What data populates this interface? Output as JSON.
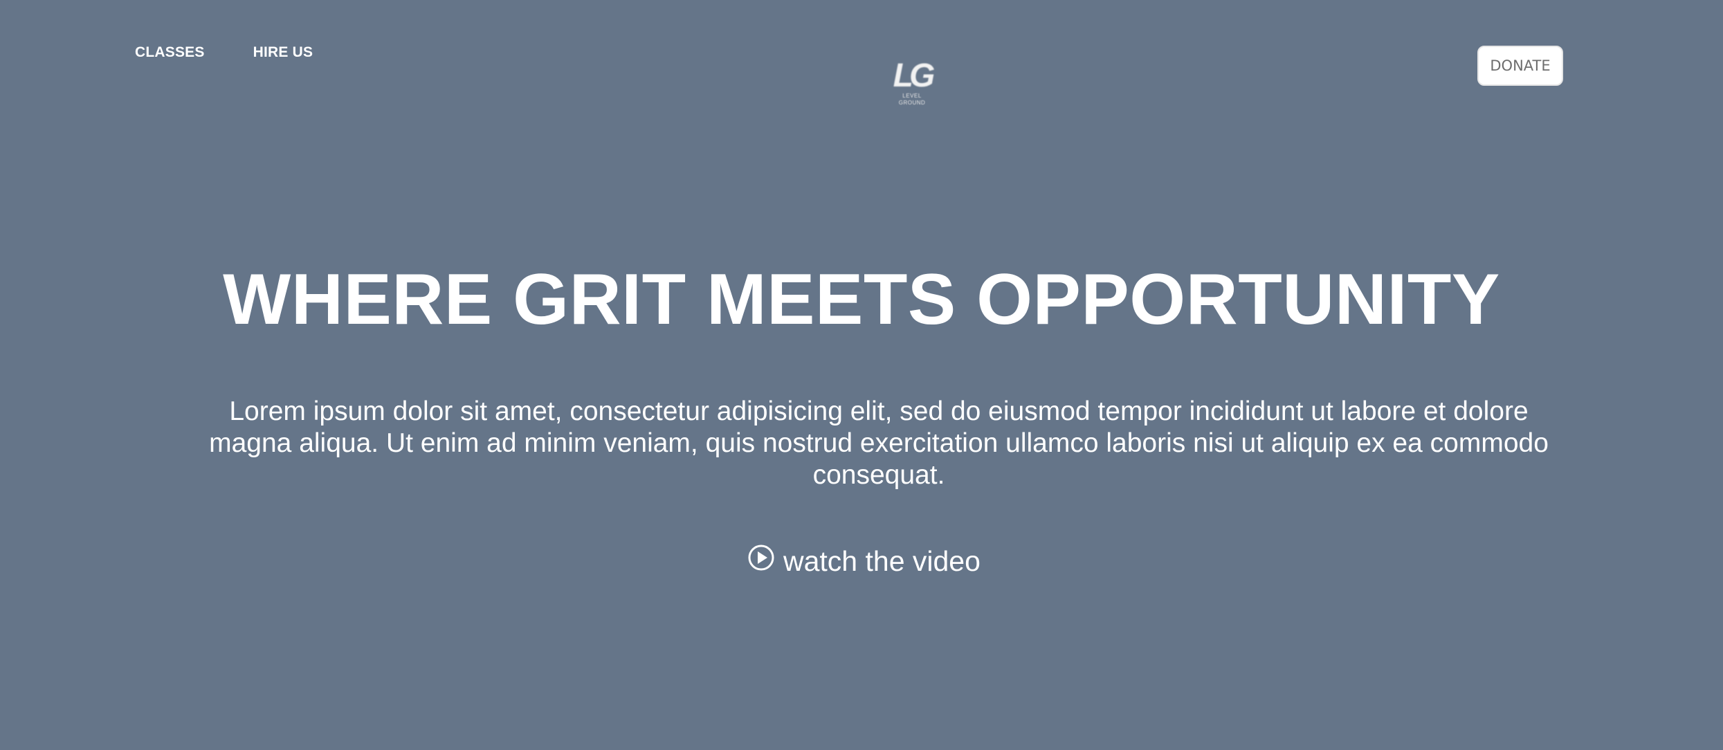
{
  "nav": {
    "items": [
      {
        "label": "CLASSES"
      },
      {
        "label": "HIRE US"
      }
    ]
  },
  "logo": {
    "mark": "LG",
    "subtext": "LEVEL GROUND"
  },
  "donate": {
    "label": "DONATE"
  },
  "hero": {
    "title": "WHERE GRIT MEETS OPPORTUNITY",
    "text": "Lorem ipsum dolor sit amet, consectetur adipisicing elit, sed do eiusmod tempor incididunt ut labore et dolore magna aliqua. Ut enim ad minim veniam, quis nostrud exercitation ullamco laboris nisi ut aliquip ex ea commodo consequat.",
    "video_link": "watch the video"
  },
  "colors": {
    "background": "#657589",
    "text": "#ffffff",
    "button_bg": "#ffffff",
    "button_text": "#6d6d6d"
  },
  "icons": {
    "video": "play-circle-icon"
  }
}
